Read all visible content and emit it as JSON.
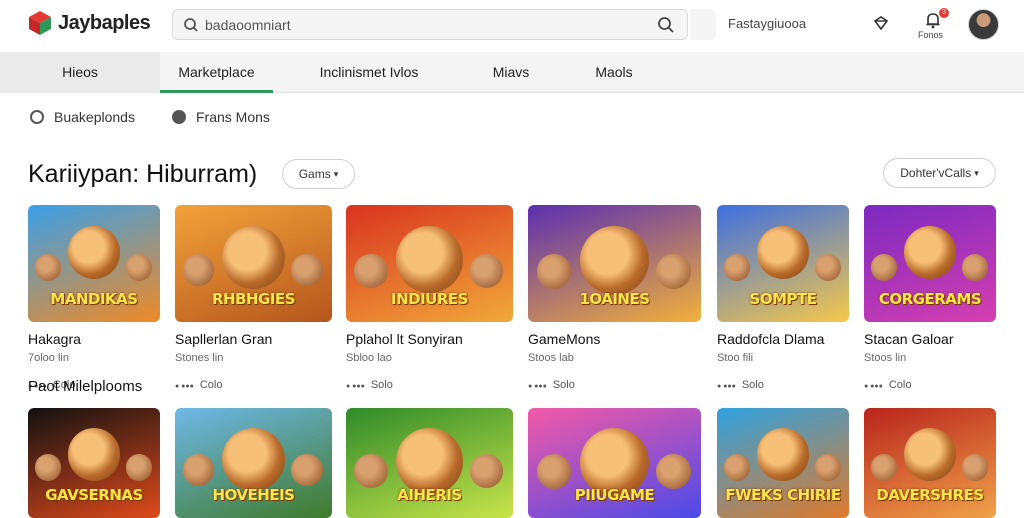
{
  "header": {
    "logo_text": "Jaybaples",
    "search_value": "badaoomniart",
    "right_text": "Fastaygiuooa",
    "notif_badge": "3",
    "notif_label": "Fonos"
  },
  "nav": {
    "tabs": [
      "Hieos",
      "Marketplace",
      "Inclinismet Ivlos",
      "Miavs",
      "Maols"
    ],
    "active_index": 1
  },
  "filters": [
    "Buakeplonds",
    "Frans Mons"
  ],
  "section": {
    "title": "Kariiypan:  Hiburram)",
    "games_pill": "Gams",
    "sort_pill": "Dohter'vCalls"
  },
  "row1": [
    {
      "banner": "MANDIKAS",
      "title": "Hakagra",
      "sub": "7oloo lin",
      "meta": "Colo",
      "colors": [
        "#3aa0e8",
        "#f08a24"
      ]
    },
    {
      "banner": "RHBHGIES",
      "title": "Sapllerlan Gran",
      "sub": "Stones lin",
      "meta": "Colo",
      "colors": [
        "#f2a23a",
        "#b5561d"
      ]
    },
    {
      "banner": "INDIURES",
      "title": "Pplahol lt Sonyiran",
      "sub": "Sbloo lao",
      "meta": "Solo",
      "colors": [
        "#d9331f",
        "#f0a93a"
      ]
    },
    {
      "banner": "1OAINES",
      "title": "GameMons",
      "sub": "Stoos lab",
      "meta": "Solo",
      "colors": [
        "#5a2fb0",
        "#f2b13a"
      ]
    },
    {
      "banner": "SOMPTE",
      "title": "Raddofcla Dlama",
      "sub": "Stoo fili",
      "meta": "Solo",
      "colors": [
        "#3d6fe0",
        "#f5c84a"
      ]
    },
    {
      "banner": "CORGERAMS",
      "title": "Stacan Galoar",
      "sub": "Stoos lin",
      "meta": "Colo",
      "colors": [
        "#7a2ac0",
        "#d63fb0"
      ]
    }
  ],
  "row2_title": "Paot Milelplooms",
  "row2": [
    {
      "banner": "GAVSERNAS",
      "colors": [
        "#111111",
        "#e04a1c"
      ]
    },
    {
      "banner": "HOVEHEIS",
      "colors": [
        "#6fb8e8",
        "#3f7a2a"
      ]
    },
    {
      "banner": "AIHERIS",
      "colors": [
        "#2f8a2a",
        "#c9e44a"
      ]
    },
    {
      "banner": "PIIUGAME",
      "colors": [
        "#f25aa6",
        "#4a4ae8"
      ]
    },
    {
      "banner": "FWEKS CHIRIE",
      "colors": [
        "#2fa2e0",
        "#e07a2a"
      ]
    },
    {
      "banner": "DAVERSHRES",
      "colors": [
        "#b8241c",
        "#f0a24a"
      ]
    }
  ]
}
